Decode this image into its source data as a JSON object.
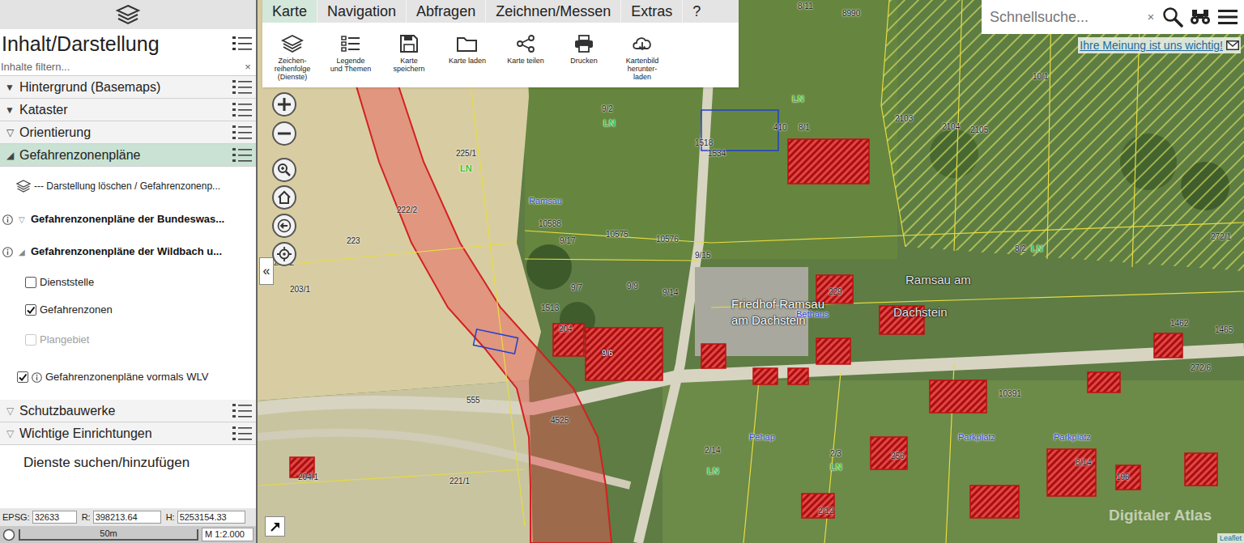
{
  "sidebar": {
    "title": "Inhalt/Darstellung",
    "filter": {
      "placeholder": "Inhalte filtern...",
      "clear": "×"
    },
    "groups": [
      {
        "icon": "▼",
        "label": "Hintergrund (Basemaps)",
        "selected": false
      },
      {
        "icon": "▼",
        "label": "Kataster",
        "selected": false
      },
      {
        "icon": "▽",
        "label": "Orientierung",
        "selected": false
      },
      {
        "icon": "◢",
        "label": "Gefahrenzonenpläne",
        "selected": true
      }
    ],
    "layers": [
      {
        "kind": "action",
        "label": "--- Darstellung löschen / Gefahrenzonenp..."
      },
      {
        "kind": "folder",
        "icon": "▽",
        "label": "Gefahrenzonenpläne der Bundeswas...",
        "info": true
      },
      {
        "kind": "folder",
        "icon": "◢",
        "label": "Gefahrenzonenpläne der Wildbach u...",
        "info": true
      },
      {
        "kind": "checkbox",
        "label": "Dienststelle",
        "checked": false,
        "disabled": false,
        "info": false
      },
      {
        "kind": "checkbox",
        "label": "Gefahrenzonen",
        "checked": true,
        "disabled": false,
        "info": false
      },
      {
        "kind": "checkbox",
        "label": "Plangebiet",
        "checked": false,
        "disabled": true,
        "info": false
      },
      {
        "kind": "checkbox",
        "label": "Gefahrenzonenpläne vormals WLV",
        "checked": true,
        "disabled": false,
        "info": true
      }
    ],
    "more_groups": [
      {
        "icon": "▽",
        "label": "Schutzbauwerke"
      },
      {
        "icon": "▽",
        "label": "Wichtige Einrichtungen"
      }
    ],
    "services": "Dienste suchen/hinzufügen",
    "collapse": "«"
  },
  "coords": {
    "epsg_label": "EPSG:",
    "epsg": "32633",
    "r_label": "R:",
    "r": "398213.64",
    "h_label": "H:",
    "h": "5253154.33"
  },
  "scale": {
    "distance": "50m",
    "ratio": "M 1:2.000"
  },
  "toolbar": {
    "tabs": [
      {
        "label": "Karte",
        "selected": true
      },
      {
        "label": "Navigation",
        "selected": false
      },
      {
        "label": "Abfragen",
        "selected": false
      },
      {
        "label": "Zeichnen/Messen",
        "selected": false
      },
      {
        "label": "Extras",
        "selected": false
      },
      {
        "label": "?",
        "selected": false
      }
    ],
    "buttons": [
      "Zeichen-\nreihenfolge\n(Dienste)",
      "Legende\nund Themen",
      "Karte\nspeichern",
      "Karte laden",
      "Karte teilen",
      "Drucken",
      "Kartenbild\nherunter-\nladen"
    ]
  },
  "search": {
    "placeholder": "Schnellsuche...",
    "clear": "×"
  },
  "feedback": "Ihre Meinung ist uns wichtig!",
  "map": {
    "watermark": "Digitaler Atlas",
    "attribution": "Leaflet",
    "labels": [
      {
        "text": "8/11",
        "kind": "parcel",
        "color": "#1a1a1a"
      },
      {
        "text": "8990",
        "kind": "parcel",
        "color": "#1a1a1a"
      },
      {
        "text": "10/1",
        "kind": "parcel",
        "color": "#1a1a1a"
      },
      {
        "text": "9/2",
        "kind": "parcel",
        "color": "#1a1a1a"
      },
      {
        "text": "LN",
        "kind": "use",
        "color": "#33c433"
      },
      {
        "text": "LN",
        "kind": "use",
        "color": "#33c433"
      },
      {
        "text": "410",
        "kind": "parcel",
        "color": "#1a1a1a"
      },
      {
        "text": "8/1",
        "kind": "parcel",
        "color": "#1a1a1a"
      },
      {
        "text": "1518",
        "kind": "parcel",
        "color": "#1a1a1a"
      },
      {
        "text": "1534",
        "kind": "parcel",
        "color": "#1a1a1a"
      },
      {
        "text": "2103",
        "kind": "parcel",
        "color": "#1a1a1a"
      },
      {
        "text": "2104",
        "kind": "parcel",
        "color": "#1a1a1a"
      },
      {
        "text": "2105",
        "kind": "parcel",
        "color": "#1a1a1a"
      },
      {
        "text": "225/1",
        "kind": "parcel",
        "color": "#1a1a1a"
      },
      {
        "text": "LN",
        "kind": "use",
        "color": "#33c433"
      },
      {
        "text": "Ramsau",
        "kind": "name",
        "color": "#2848d8"
      },
      {
        "text": "222/2",
        "kind": "parcel",
        "color": "#1a1a1a"
      },
      {
        "text": "223",
        "kind": "parcel",
        "color": "#1a1a1a"
      },
      {
        "text": "203/2",
        "kind": "parcel",
        "color": "#1a1a1a"
      },
      {
        "text": "203/1",
        "kind": "parcel",
        "color": "#1a1a1a"
      },
      {
        "text": "10588",
        "kind": "parcel",
        "color": "#1a1a1a"
      },
      {
        "text": "10575",
        "kind": "parcel",
        "color": "#1a1a1a"
      },
      {
        "text": "10576",
        "kind": "parcel",
        "color": "#1a1a1a"
      },
      {
        "text": "9/17",
        "kind": "parcel",
        "color": "#1a1a1a"
      },
      {
        "text": "9/15",
        "kind": "parcel",
        "color": "#1a1a1a"
      },
      {
        "text": "8/2",
        "kind": "parcel",
        "color": "#1a1a1a"
      },
      {
        "text": "LN",
        "kind": "use",
        "color": "#33c433"
      },
      {
        "text": "272/1",
        "kind": "parcel",
        "color": "#1a1a1a"
      },
      {
        "text": "9/7",
        "kind": "parcel",
        "color": "#1a1a1a"
      },
      {
        "text": "9/9",
        "kind": "parcel",
        "color": "#1a1a1a"
      },
      {
        "text": "9/14",
        "kind": "parcel",
        "color": "#1a1a1a"
      },
      {
        "text": "Ramsau am",
        "kind": "place",
        "color": "#e6e6e6"
      },
      {
        "text": "229",
        "kind": "parcel",
        "color": "#1a1a1a"
      },
      {
        "text": "1513",
        "kind": "parcel",
        "color": "#1a1a1a"
      },
      {
        "text": "Friedhof Ramsau",
        "kind": "place",
        "color": "#ffffff"
      },
      {
        "text": "am Dachstein",
        "kind": "place",
        "color": "#ffffff"
      },
      {
        "text": "Bethaus",
        "kind": "name",
        "color": "#2848d8"
      },
      {
        "text": "Dachstein",
        "kind": "place",
        "color": "#e6e6e6"
      },
      {
        "text": "204",
        "kind": "parcel",
        "color": "#1a1a1a"
      },
      {
        "text": "9/6",
        "kind": "parcel",
        "color": "#ffffff"
      },
      {
        "text": "1462",
        "kind": "parcel",
        "color": "#1a1a1a"
      },
      {
        "text": "1465",
        "kind": "parcel",
        "color": "#1a1a1a"
      },
      {
        "text": "272/6",
        "kind": "parcel",
        "color": "#1a1a1a"
      },
      {
        "text": "10391",
        "kind": "parcel",
        "color": "#1a1a1a"
      },
      {
        "text": "555",
        "kind": "parcel",
        "color": "#1a1a1a"
      },
      {
        "text": "4525",
        "kind": "parcel",
        "color": "#1a1a1a"
      },
      {
        "text": "Pehap",
        "kind": "name",
        "color": "#2848d8"
      },
      {
        "text": "Parkplatz",
        "kind": "name",
        "color": "#2848d8"
      },
      {
        "text": "Parkplatz",
        "kind": "name",
        "color": "#2848d8"
      },
      {
        "text": "2/14",
        "kind": "parcel",
        "color": "#1a1a1a"
      },
      {
        "text": "LN",
        "kind": "use",
        "color": "#33c433"
      },
      {
        "text": "2/3",
        "kind": "parcel",
        "color": "#1a1a1a"
      },
      {
        "text": "LN",
        "kind": "use",
        "color": "#33c433"
      },
      {
        "text": "256",
        "kind": "parcel",
        "color": "#1a1a1a"
      },
      {
        "text": "8/14",
        "kind": "parcel",
        "color": "#1a1a1a"
      },
      {
        "text": "196",
        "kind": "parcel",
        "color": "#1a1a1a"
      },
      {
        "text": "221/1",
        "kind": "parcel",
        "color": "#1a1a1a"
      },
      {
        "text": "204/1",
        "kind": "parcel",
        "color": "#1a1a1a"
      },
      {
        "text": "2/12",
        "kind": "parcel",
        "color": "#1a1a1a"
      }
    ]
  }
}
